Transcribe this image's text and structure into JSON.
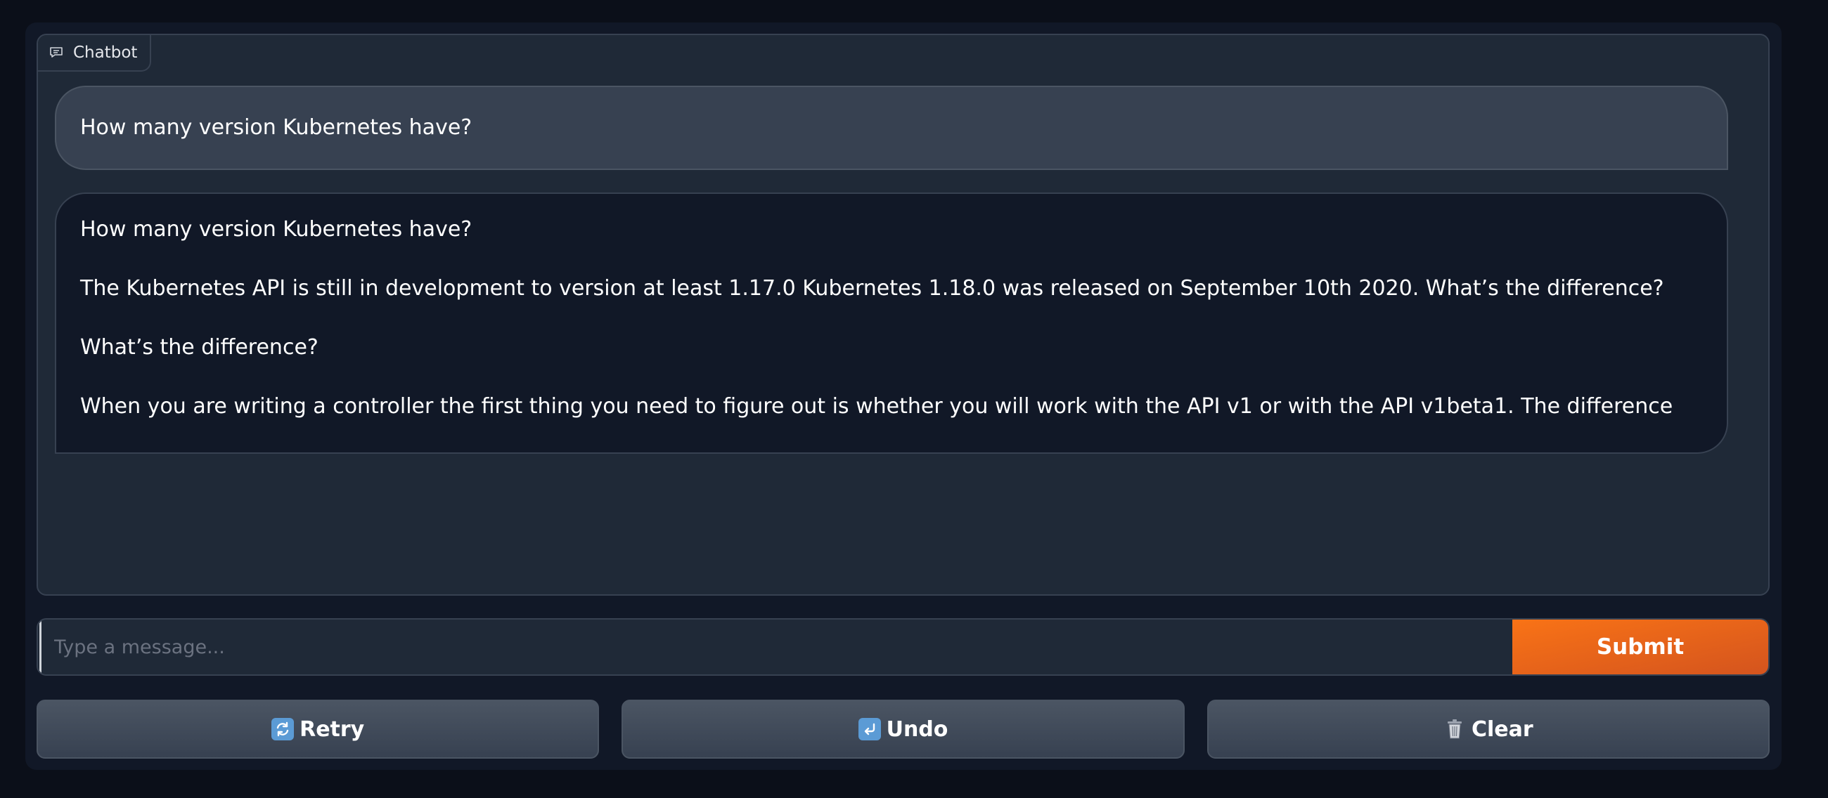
{
  "chatbot": {
    "label": "Chatbot",
    "icon": "chat-bubble-icon"
  },
  "messages": [
    {
      "role": "user",
      "text": "How many version Kubernetes have?"
    },
    {
      "role": "bot",
      "paragraphs": [
        "How many version Kubernetes have?",
        "The Kubernetes API is still in development to version at least 1.17.0 Kubernetes 1.18.0 was released on September 10th 2020. What’s the difference?",
        "What’s the difference?",
        "When you are writing a controller the first thing you need to figure out is whether you will work with the API v1 or with the API v1beta1. The difference"
      ]
    }
  ],
  "input": {
    "placeholder": "Type a message...",
    "value": ""
  },
  "submit_label": "Submit",
  "buttons": {
    "retry": {
      "label": "Retry",
      "icon": "retry-icon"
    },
    "undo": {
      "label": "Undo",
      "icon": "undo-icon"
    },
    "clear": {
      "label": "Clear",
      "icon": "trash-icon"
    }
  },
  "colors": {
    "accent": "#f97316",
    "background": "#0b0f19",
    "panel": "#1f2937"
  }
}
